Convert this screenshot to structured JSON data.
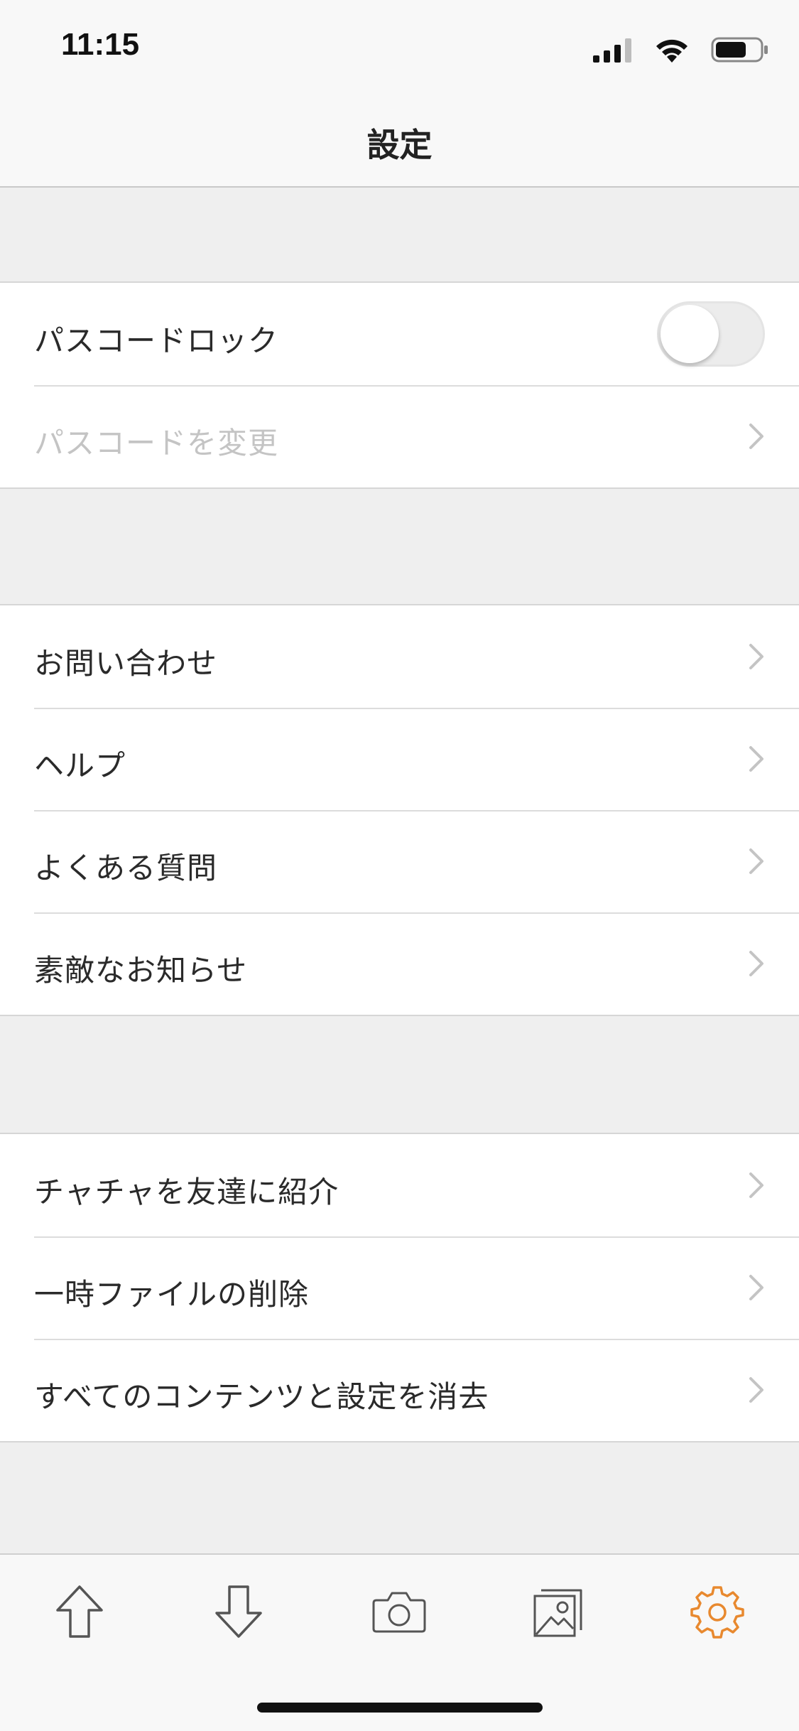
{
  "status_bar": {
    "time": "11:15"
  },
  "nav": {
    "title": "設定"
  },
  "sections": [
    {
      "rows": [
        {
          "label": "パスコードロック",
          "accessory": "toggle",
          "toggle_on": false
        },
        {
          "label": "パスコードを変更",
          "accessory": "chevron-right-icon",
          "disabled": true
        }
      ]
    },
    {
      "rows": [
        {
          "label": "お問い合わせ",
          "accessory": "chevron-right-icon"
        },
        {
          "label": "ヘルプ",
          "accessory": "chevron-right-icon"
        },
        {
          "label": "よくある質問",
          "accessory": "chevron-right-icon"
        },
        {
          "label": "素敵なお知らせ",
          "accessory": "chevron-right-icon"
        }
      ]
    },
    {
      "rows": [
        {
          "label": "チャチャを友達に紹介",
          "accessory": "chevron-right-icon"
        },
        {
          "label": "一時ファイルの削除",
          "accessory": "chevron-right-icon"
        },
        {
          "label": "すべてのコンテンツと設定を消去",
          "accessory": "chevron-right-icon"
        }
      ]
    }
  ],
  "tab_bar": {
    "items": [
      {
        "icon": "upload-arrow-icon",
        "active": false
      },
      {
        "icon": "download-arrow-icon",
        "active": false
      },
      {
        "icon": "camera-icon",
        "active": false
      },
      {
        "icon": "photo-gallery-icon",
        "active": false
      },
      {
        "icon": "gear-icon",
        "active": true
      }
    ],
    "active_color": "#E8892F",
    "inactive_color": "#555555"
  }
}
